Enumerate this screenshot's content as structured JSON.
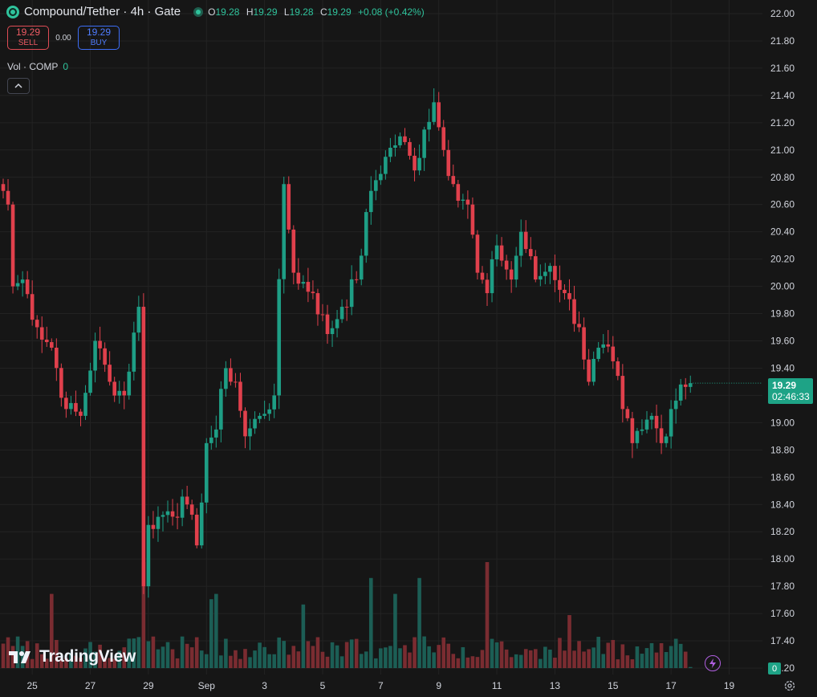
{
  "legend": {
    "title": "Compound/Tether · 4h · Gate",
    "ohlc": [
      {
        "k": "O",
        "v": "19.28"
      },
      {
        "k": "H",
        "v": "19.29"
      },
      {
        "k": "L",
        "v": "19.28"
      },
      {
        "k": "C",
        "v": "19.29"
      }
    ],
    "change": "+0.08 (+0.42%)"
  },
  "trade": {
    "sell_price": "19.29",
    "sell_label": "SELL",
    "spread": "0.00",
    "buy_price": "19.29",
    "buy_label": "BUY"
  },
  "volume_legend": {
    "label": "Vol · COMP",
    "value": "0"
  },
  "price_tag": {
    "price": "19.29",
    "countdown": "02:46:33"
  },
  "volume_tag": "0",
  "brand": "TradingView",
  "colors": {
    "up": "#1e9e85",
    "down": "#e0404c",
    "vol_up": "#1c5e55",
    "vol_down": "#7a2c31",
    "accent": "#2fc39c"
  },
  "chart_data": {
    "type": "candlestick",
    "interval": "4h",
    "ylim": [
      17.2,
      22.0
    ],
    "y_ticks": [
      "22.00",
      "21.80",
      "21.60",
      "21.40",
      "21.20",
      "21.00",
      "20.80",
      "20.60",
      "20.40",
      "20.20",
      "20.00",
      "19.80",
      "19.60",
      "19.40",
      "19.20",
      "19.00",
      "18.80",
      "18.60",
      "18.40",
      "18.20",
      "18.00",
      "17.80",
      "17.60",
      "17.40",
      "17.20"
    ],
    "x_ticks": [
      {
        "label": "25",
        "i": 6
      },
      {
        "label": "27",
        "i": 18
      },
      {
        "label": "29",
        "i": 30
      },
      {
        "label": "Sep",
        "i": 42
      },
      {
        "label": "3",
        "i": 54
      },
      {
        "label": "5",
        "i": 66
      },
      {
        "label": "7",
        "i": 78
      },
      {
        "label": "9",
        "i": 90
      },
      {
        "label": "11",
        "i": 102
      },
      {
        "label": "13",
        "i": 114
      },
      {
        "label": "15",
        "i": 126
      },
      {
        "label": "17",
        "i": 138
      },
      {
        "label": "19",
        "i": 150
      }
    ],
    "close_anchors": [
      {
        "i": 0,
        "v": 20.7
      },
      {
        "i": 1,
        "v": 20.6
      },
      {
        "i": 2,
        "v": 20.0
      },
      {
        "i": 4,
        "v": 20.05
      },
      {
        "i": 7,
        "v": 19.7
      },
      {
        "i": 10,
        "v": 19.55
      },
      {
        "i": 13,
        "v": 19.1
      },
      {
        "i": 16,
        "v": 19.05
      },
      {
        "i": 19,
        "v": 19.6
      },
      {
        "i": 22,
        "v": 19.3
      },
      {
        "i": 25,
        "v": 19.2
      },
      {
        "i": 28,
        "v": 19.85
      },
      {
        "i": 29,
        "v": 17.8
      },
      {
        "i": 30,
        "v": 18.25
      },
      {
        "i": 34,
        "v": 18.35
      },
      {
        "i": 38,
        "v": 18.4
      },
      {
        "i": 40,
        "v": 18.1
      },
      {
        "i": 42,
        "v": 18.85
      },
      {
        "i": 44,
        "v": 18.95
      },
      {
        "i": 46,
        "v": 19.4
      },
      {
        "i": 48,
        "v": 19.3
      },
      {
        "i": 50,
        "v": 18.9
      },
      {
        "i": 53,
        "v": 19.05
      },
      {
        "i": 56,
        "v": 19.2
      },
      {
        "i": 58,
        "v": 20.75
      },
      {
        "i": 60,
        "v": 20.1
      },
      {
        "i": 64,
        "v": 19.95
      },
      {
        "i": 67,
        "v": 19.65
      },
      {
        "i": 70,
        "v": 19.85
      },
      {
        "i": 73,
        "v": 20.05
      },
      {
        "i": 76,
        "v": 20.7
      },
      {
        "i": 79,
        "v": 20.95
      },
      {
        "i": 82,
        "v": 21.1
      },
      {
        "i": 85,
        "v": 20.85
      },
      {
        "i": 87,
        "v": 21.15
      },
      {
        "i": 89,
        "v": 21.35
      },
      {
        "i": 91,
        "v": 21.0
      },
      {
        "i": 93,
        "v": 20.75
      },
      {
        "i": 96,
        "v": 20.6
      },
      {
        "i": 98,
        "v": 20.1
      },
      {
        "i": 100,
        "v": 19.95
      },
      {
        "i": 102,
        "v": 20.3
      },
      {
        "i": 105,
        "v": 20.05
      },
      {
        "i": 107,
        "v": 20.4
      },
      {
        "i": 110,
        "v": 20.05
      },
      {
        "i": 113,
        "v": 20.15
      },
      {
        "i": 116,
        "v": 19.95
      },
      {
        "i": 119,
        "v": 19.7
      },
      {
        "i": 121,
        "v": 19.3
      },
      {
        "i": 123,
        "v": 19.55
      },
      {
        "i": 126,
        "v": 19.45
      },
      {
        "i": 128,
        "v": 19.1
      },
      {
        "i": 130,
        "v": 18.85
      },
      {
        "i": 132,
        "v": 18.95
      },
      {
        "i": 134,
        "v": 19.05
      },
      {
        "i": 136,
        "v": 18.85
      },
      {
        "i": 138,
        "v": 19.1
      },
      {
        "i": 140,
        "v": 19.28
      },
      {
        "i": 142,
        "v": 19.29
      }
    ],
    "volume_spikes": [
      {
        "i": 10,
        "v": 0.7
      },
      {
        "i": 29,
        "v": 1.0
      },
      {
        "i": 43,
        "v": 0.65
      },
      {
        "i": 44,
        "v": 0.7
      },
      {
        "i": 62,
        "v": 0.6
      },
      {
        "i": 76,
        "v": 0.85
      },
      {
        "i": 81,
        "v": 0.7
      },
      {
        "i": 86,
        "v": 0.85
      },
      {
        "i": 100,
        "v": 1.0
      },
      {
        "i": 117,
        "v": 0.5
      }
    ]
  }
}
